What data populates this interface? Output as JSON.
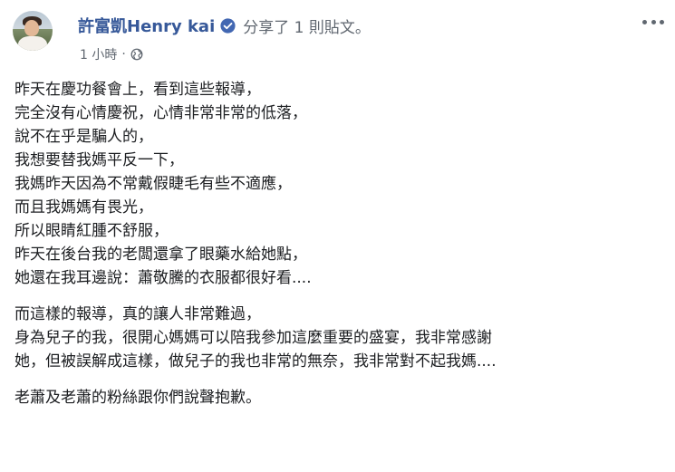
{
  "post": {
    "author": "許富凱Henry kai",
    "action_text": "分享了 1 則貼文。",
    "time": "1 小時",
    "separator": "·",
    "privacy_icon": "globe-icon",
    "more_icon": "more-options-icon",
    "verified_icon": "verified-badge-icon",
    "colors": {
      "author_link": "#365899",
      "verified_badge": "#4267b2",
      "secondary_text": "#606770",
      "body_text": "#1c1e21"
    },
    "paragraphs": [
      {
        "lines": [
          "昨天在慶功餐會上，看到這些報導，",
          "完全沒有心情慶祝，心情非常非常的低落，",
          "說不在乎是騙人的，",
          "我想要替我媽平反一下，",
          "我媽昨天因為不常戴假睫毛有些不適應，",
          "而且我媽媽有畏光，",
          "所以眼睛紅腫不舒服，",
          "昨天在後台我的老闆還拿了眼藥水給她點，",
          "她還在我耳邊說：蕭敬騰的衣服都很好看...."
        ]
      },
      {
        "lines": [
          "而這樣的報導，真的讓人非常難過，",
          "身為兒子的我，很開心媽媽可以陪我參加這麼重要的盛宴，我非常感謝",
          "她，但被誤解成這樣，做兒子的我也非常的無奈，我非常對不起我媽...."
        ]
      },
      {
        "lines": [
          "老蕭及老蕭的粉絲跟你們說聲抱歉。"
        ]
      }
    ]
  }
}
